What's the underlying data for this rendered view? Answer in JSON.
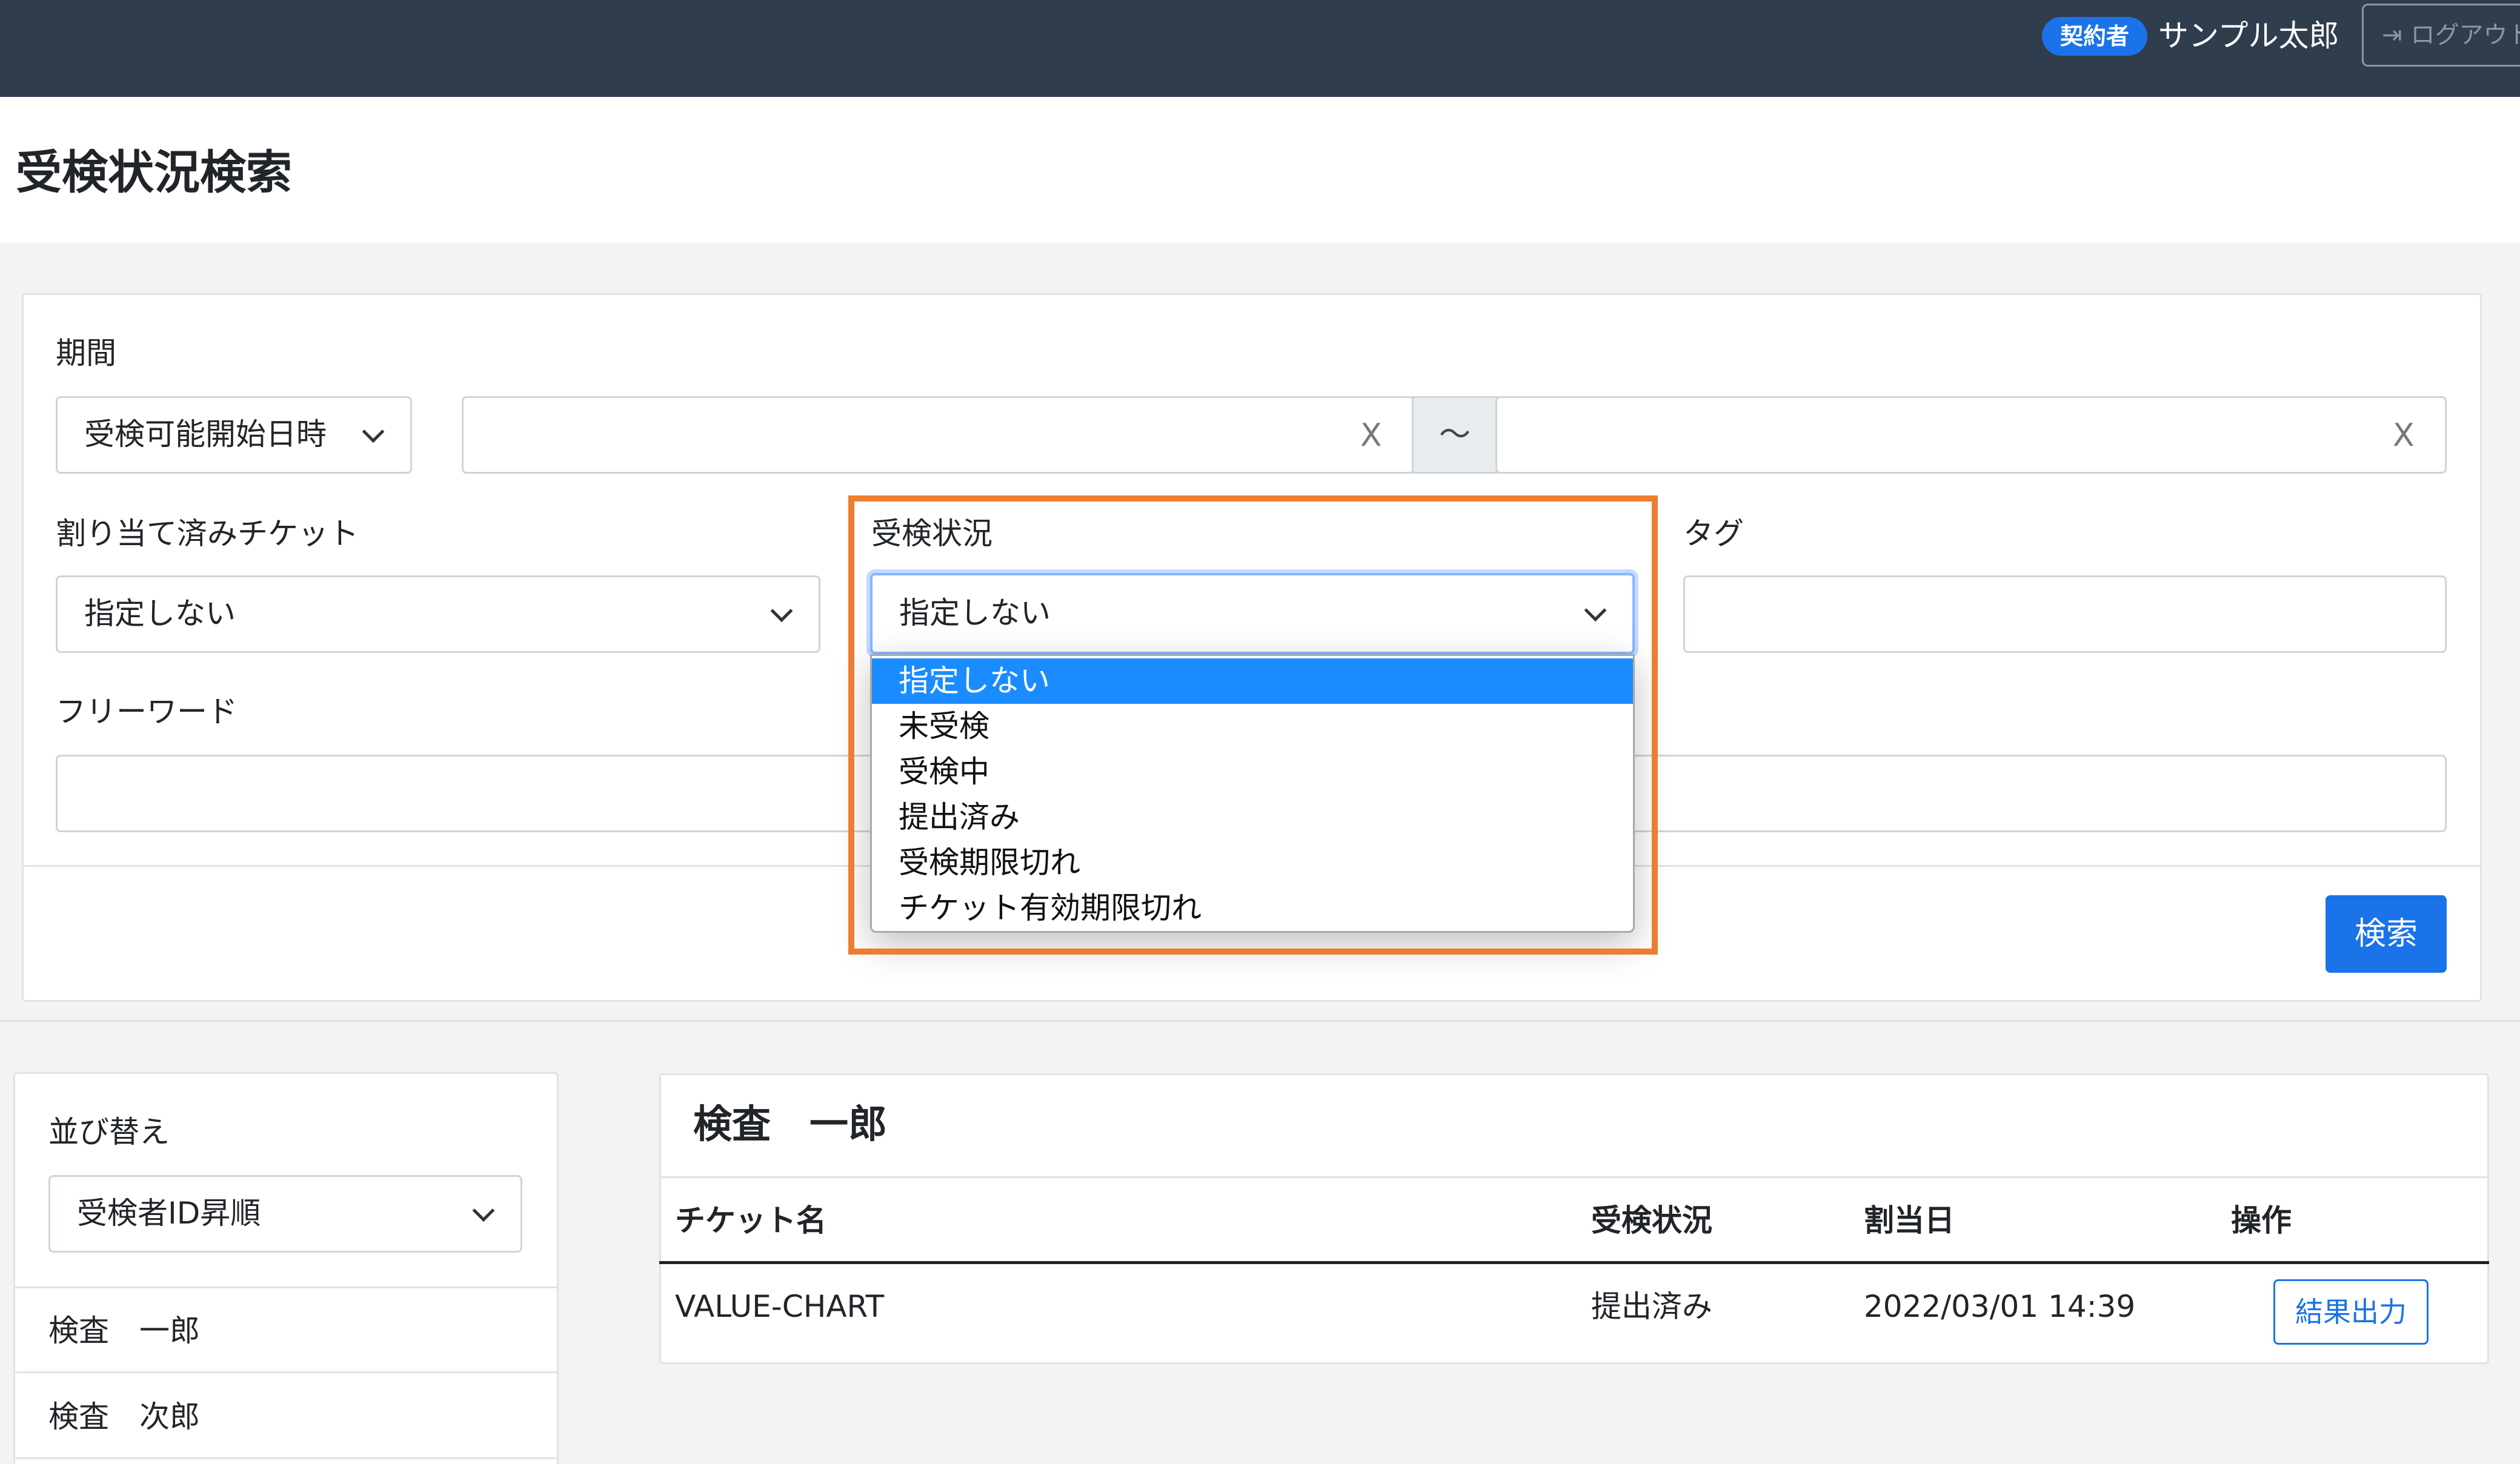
{
  "header": {
    "role_badge": "契約者",
    "user_name": "サンプル太郎",
    "logout_label": "ログアウト"
  },
  "page": {
    "title": "受検状況検索"
  },
  "search": {
    "period_label": "期間",
    "period_type_value": "受検可能開始日時",
    "date_from_value": "",
    "date_to_value": "",
    "clear_glyph": "X",
    "range_separator": "〜",
    "assigned_ticket_label": "割り当て済みチケット",
    "assigned_ticket_value": "指定しない",
    "exam_status_label": "受検状況",
    "exam_status_value": "指定しない",
    "exam_status_options": [
      "指定しない",
      "未受検",
      "受検中",
      "提出済み",
      "受検期限切れ",
      "チケット有効期限切れ"
    ],
    "tag_label": "タグ",
    "tag_value": "",
    "freeword_label": "フリーワード",
    "freeword_value": "",
    "search_button": "検索"
  },
  "sort": {
    "label": "並び替え",
    "value": "受検者ID昇順",
    "people": [
      "検査　一郎",
      "検査　次郎"
    ]
  },
  "result": {
    "examinee_name": "検査　一郎",
    "columns": [
      "チケット名",
      "受検状況",
      "割当日",
      "操作"
    ],
    "rows": [
      {
        "ticket": "VALUE-CHART",
        "status": "提出済み",
        "assigned": "2022/03/01 14:39",
        "action": "結果出力"
      }
    ]
  },
  "colors": {
    "topbar": "#2f3d4d",
    "primary": "#1a73e8",
    "highlight": "#ed7d31",
    "dropdown_selected": "#1a8cff"
  }
}
